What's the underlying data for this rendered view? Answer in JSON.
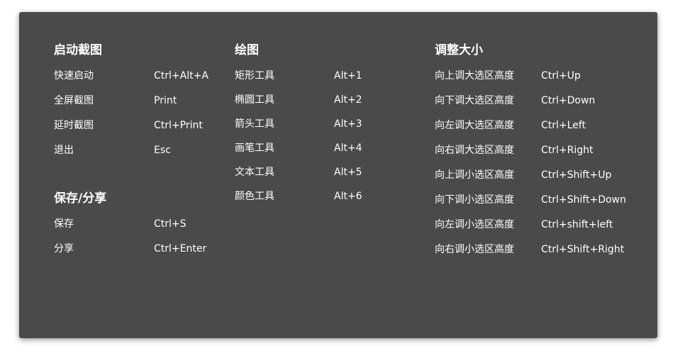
{
  "sections": {
    "start": {
      "title": "启动截图",
      "items": [
        {
          "label": "快速启动",
          "key": "Ctrl+Alt+A"
        },
        {
          "label": "全屏截图",
          "key": "Print"
        },
        {
          "label": "延时截图",
          "key": "Ctrl+Print"
        },
        {
          "label": "退出",
          "key": "Esc"
        }
      ]
    },
    "save": {
      "title": "保存/分享",
      "items": [
        {
          "label": "保存",
          "key": "Ctrl+S"
        },
        {
          "label": "分享",
          "key": "Ctrl+Enter"
        }
      ]
    },
    "draw": {
      "title": "绘图",
      "items": [
        {
          "label": "矩形工具",
          "key": "Alt+1"
        },
        {
          "label": "椭圆工具",
          "key": "Alt+2"
        },
        {
          "label": "箭头工具",
          "key": "Alt+3"
        },
        {
          "label": "画笔工具",
          "key": "Alt+4"
        },
        {
          "label": "文本工具",
          "key": "Alt+5"
        },
        {
          "label": "颜色工具",
          "key": "Alt+6"
        }
      ]
    },
    "resize": {
      "title": "调整大小",
      "items": [
        {
          "label": "向上调大选区高度",
          "key": "Ctrl+Up"
        },
        {
          "label": "向下调大选区高度",
          "key": "Ctrl+Down"
        },
        {
          "label": "向左调大选区高度",
          "key": "Ctrl+Left"
        },
        {
          "label": "向右调大选区高度",
          "key": "Ctrl+Right"
        },
        {
          "label": "向上调小选区高度",
          "key": "Ctrl+Shift+Up"
        },
        {
          "label": "向下调小选区高度",
          "key": "Ctrl+Shift+Down"
        },
        {
          "label": "向左调小选区高度",
          "key": "Ctrl+shift+left"
        },
        {
          "label": "向右调小选区高度",
          "key": "Ctrl+Shift+Right"
        }
      ]
    }
  }
}
